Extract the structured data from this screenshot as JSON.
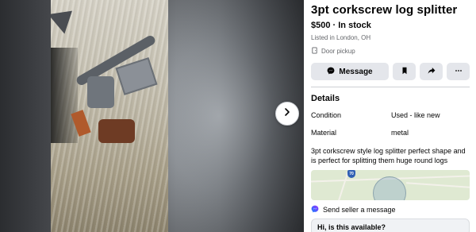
{
  "viewer": {
    "next_icon": "chevron-right-icon"
  },
  "listing": {
    "title": "3pt corkscrew log splitter",
    "price": "$500 · In stock",
    "listed": "Listed in London, OH",
    "pickup": "Door pickup",
    "pickup_icon": "door-pickup-icon"
  },
  "actions": {
    "message_label": "Message",
    "message_icon": "messenger-icon",
    "save_icon": "bookmark-icon",
    "share_icon": "share-arrow-icon",
    "more_icon": "more-dots-icon"
  },
  "details": {
    "heading": "Details",
    "rows": [
      {
        "key": "Condition",
        "value": "Used - like new"
      },
      {
        "key": "Material",
        "value": "metal"
      }
    ],
    "description": "3pt corkscrew style log splitter perfect shape and is perfect for splitting them huge round logs"
  },
  "map": {
    "shield_label": "70"
  },
  "seller": {
    "send_label": "Send seller a message",
    "send_icon": "messenger-icon",
    "message_value": "Hi, is this available?"
  },
  "colors": {
    "button_bg": "#e4e6eb",
    "secondary_text": "#65676b",
    "messenger_blue": "#0a7cff"
  }
}
